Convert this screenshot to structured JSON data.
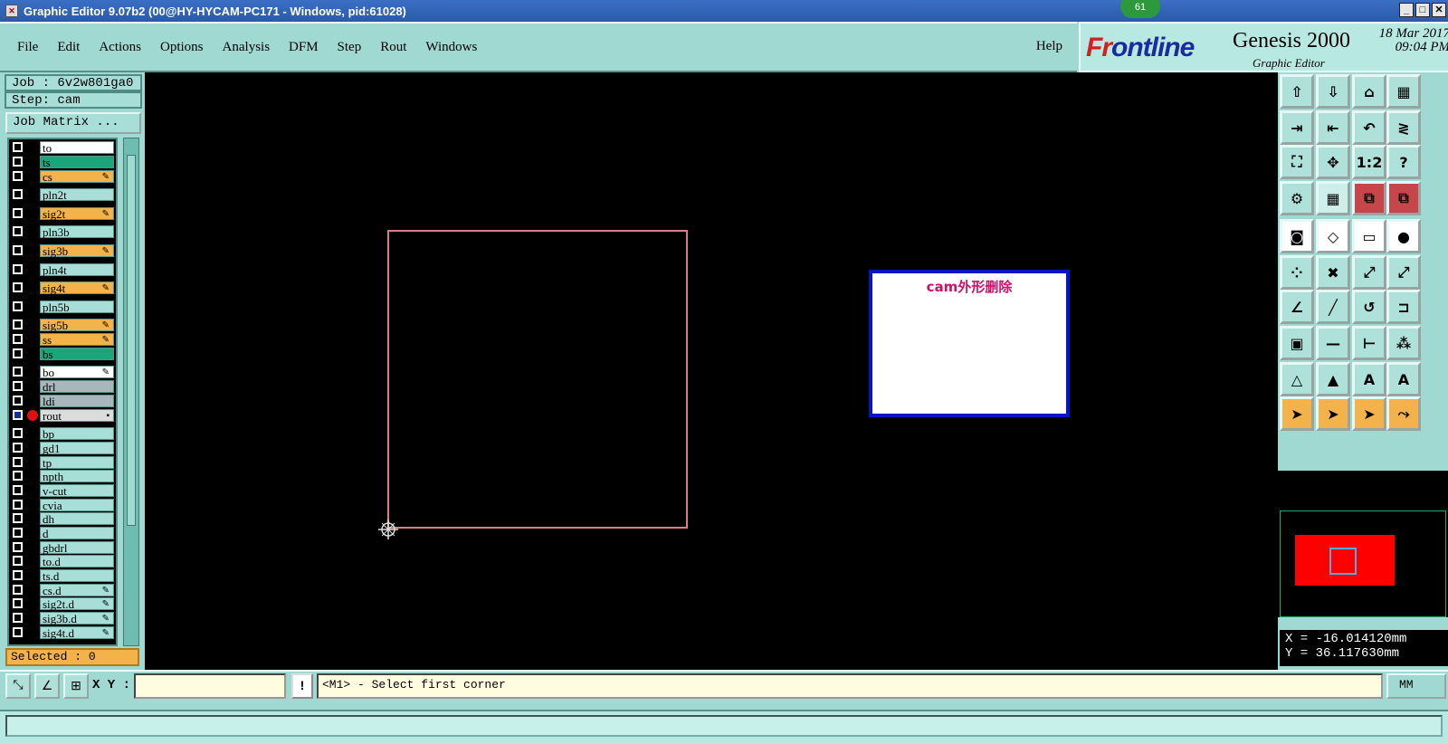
{
  "window": {
    "title": "Graphic Editor 9.07b2 (00@HY-HYCAM-PC171 - Windows, pid:61028)",
    "notification_count": "61"
  },
  "menu": {
    "items": [
      "File",
      "Edit",
      "Actions",
      "Options",
      "Analysis",
      "DFM",
      "Step",
      "Rout",
      "Windows"
    ],
    "help": "Help"
  },
  "brand": {
    "logo_prefix": "Fr",
    "logo_rest": "ontline",
    "product": "Genesis 2000",
    "subtitle": "Graphic Editor",
    "date": "18 Mar 2017",
    "time": "09:04 PM"
  },
  "left": {
    "job": "Job : 6v2w801ga0",
    "step": "Step: cam",
    "job_matrix": "Job Matrix ...",
    "selected": "Selected : 0"
  },
  "layers": [
    {
      "name": "to",
      "color": "#ffffff",
      "tail": ""
    },
    {
      "name": "ts",
      "color": "#1aa57a",
      "tail": ""
    },
    {
      "name": "cs",
      "color": "#f4b24a",
      "tail": "✎"
    },
    {
      "name": "pln2t",
      "color": "#a8ded8",
      "tail": ""
    },
    {
      "name": "sig2t",
      "color": "#f4b24a",
      "tail": "✎"
    },
    {
      "name": "pln3b",
      "color": "#a8ded8",
      "tail": ""
    },
    {
      "name": "sig3b",
      "color": "#f4b24a",
      "tail": "✎"
    },
    {
      "name": "pln4t",
      "color": "#a8ded8",
      "tail": ""
    },
    {
      "name": "sig4t",
      "color": "#f4b24a",
      "tail": "✎"
    },
    {
      "name": "pln5b",
      "color": "#a8ded8",
      "tail": ""
    },
    {
      "name": "sig5b",
      "color": "#f4b24a",
      "tail": "✎"
    },
    {
      "name": "ss",
      "color": "#f4b24a",
      "tail": "✎"
    },
    {
      "name": "bs",
      "color": "#1aa57a",
      "tail": ""
    },
    {
      "name": "bo",
      "color": "#ffffff",
      "tail": "✎"
    },
    {
      "name": "drl",
      "color": "#a7b7bb",
      "tail": ""
    },
    {
      "name": "ldi",
      "color": "#a7b7bb",
      "tail": ""
    },
    {
      "name": "rout",
      "color": "#dcdcdc",
      "tail": "▪"
    },
    {
      "name": "bp",
      "color": "#a8ded8",
      "tail": ""
    },
    {
      "name": "gd1",
      "color": "#a8ded8",
      "tail": ""
    },
    {
      "name": "tp",
      "color": "#a8ded8",
      "tail": ""
    },
    {
      "name": "npth",
      "color": "#a8ded8",
      "tail": ""
    },
    {
      "name": "v-cut",
      "color": "#a8ded8",
      "tail": ""
    },
    {
      "name": "cvia",
      "color": "#a8ded8",
      "tail": ""
    },
    {
      "name": "dh",
      "color": "#a8ded8",
      "tail": ""
    },
    {
      "name": "d",
      "color": "#a8ded8",
      "tail": ""
    },
    {
      "name": "gbdrl",
      "color": "#a8ded8",
      "tail": ""
    },
    {
      "name": "to.d",
      "color": "#a8ded8",
      "tail": ""
    },
    {
      "name": "ts.d",
      "color": "#a8ded8",
      "tail": ""
    },
    {
      "name": "cs.d",
      "color": "#a8ded8",
      "tail": "✎"
    },
    {
      "name": "sig2t.d",
      "color": "#a8ded8",
      "tail": "✎"
    },
    {
      "name": "sig3b.d",
      "color": "#a8ded8",
      "tail": "✎"
    },
    {
      "name": "sig4t.d",
      "color": "#a8ded8",
      "tail": "✎"
    }
  ],
  "canvas": {
    "note_text": "cam外形删除"
  },
  "toolbar_icons": [
    "move-to-icon",
    "move-down-icon",
    "home-icon",
    "window-icon",
    "enter-icon",
    "exit-icon",
    "undo-icon",
    "snap-icon",
    "zoom-fit-icon",
    "zoom-center-icon",
    "ratio-icon",
    "help-icon",
    "tools-icon",
    "grid-icon",
    "layers-red-icon",
    "layers-red2-icon",
    "pad-icon",
    "shape-icon",
    "ruler-icon",
    "circle-icon",
    "net-icon",
    "cross-icon",
    "connect-icon",
    "connect2-icon",
    "line-icon",
    "line2-icon",
    "arc-icon",
    "bracket-icon",
    "node-icon",
    "dash-icon",
    "measure-icon",
    "cluster-icon",
    "triangle-icon",
    "triangle2-icon",
    "triangle3-icon",
    "triangle4-icon",
    "pointer-icon",
    "pointer-box-icon",
    "pointer-oct-icon",
    "path-icon"
  ],
  "toolbar_labels": {
    "ratio": "1:2",
    "help": "?"
  },
  "coords": {
    "x": "X = -16.014120mm",
    "y": "Y =  36.117630mm"
  },
  "bottom": {
    "xy_label": "X Y :",
    "xy_value": "",
    "alert": "!",
    "prompt": "<M1> - Select first corner",
    "units": "MM"
  }
}
